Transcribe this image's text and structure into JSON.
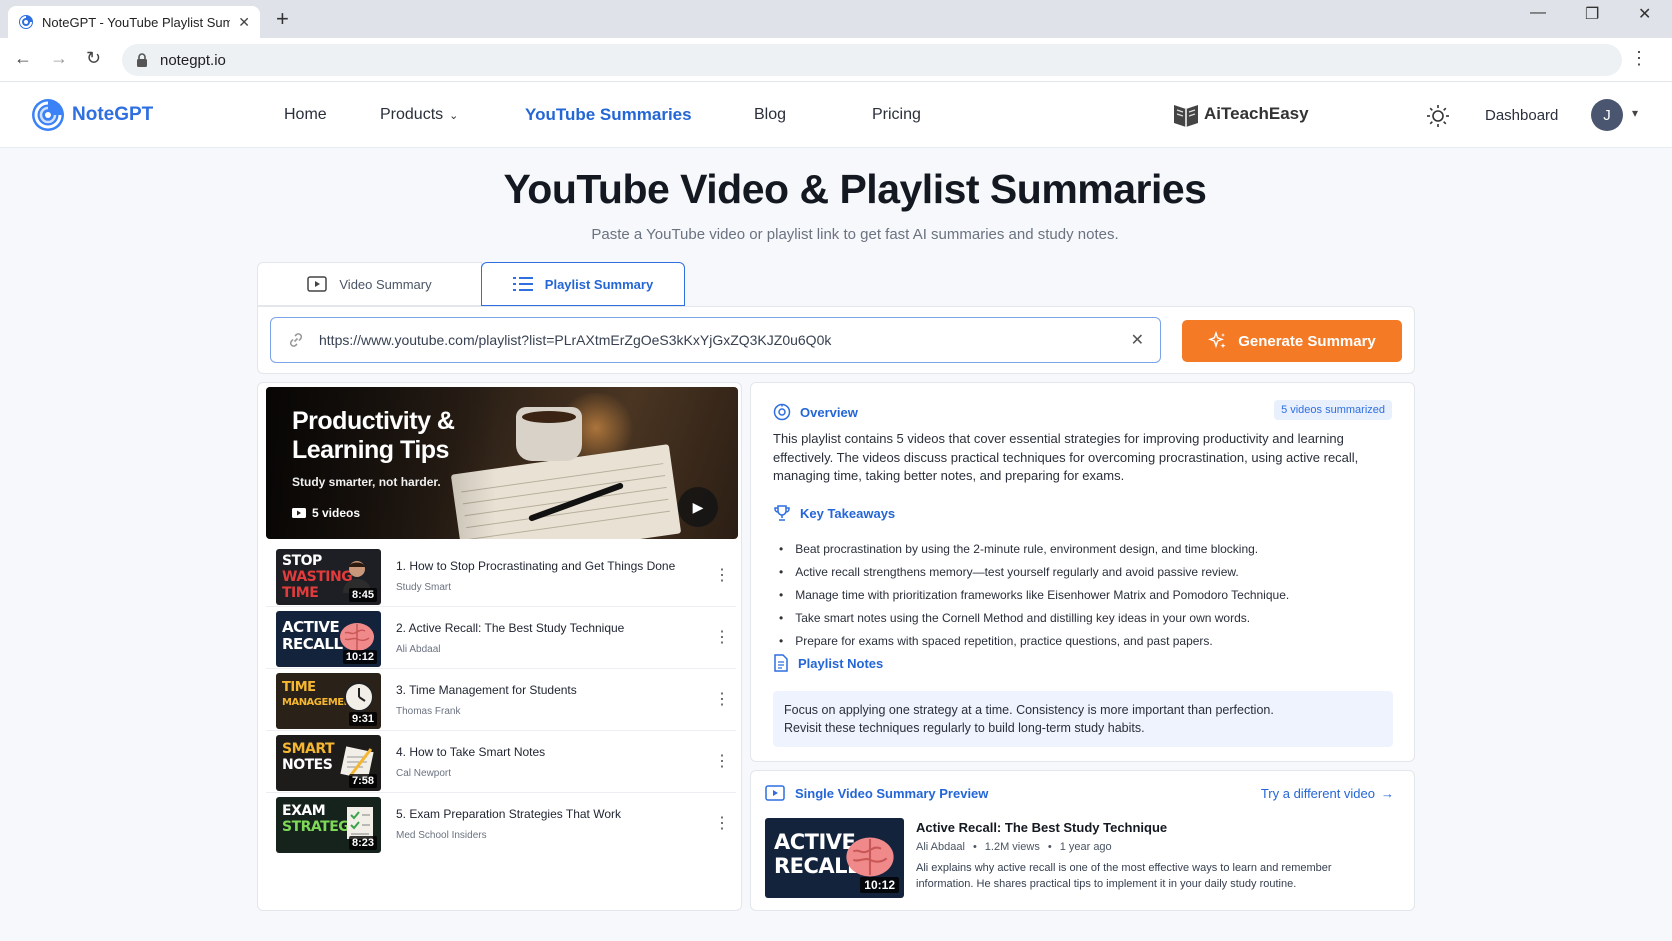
{
  "browser": {
    "tab_title": "NoteGPT - YouTube Playlist Sum",
    "url": "notegpt.io"
  },
  "header": {
    "logo": "NoteGPT",
    "nav": [
      "Home",
      "Products",
      "YouTube Summaries",
      "Blog",
      "Pricing"
    ],
    "partner": "AiTeachEasy",
    "dashboard": "Dashboard",
    "avatar_initial": "J"
  },
  "hero": {
    "title": "YouTube Video & Playlist Summaries",
    "subtitle": "Paste a YouTube video or playlist link to get fast AI summaries and study notes."
  },
  "mode_tabs": {
    "video": "Video Summary",
    "playlist": "Playlist Summary",
    "active": "playlist"
  },
  "input": {
    "value": "https://www.youtube.com/playlist?list=PLrAXtmErZgOeS3kKxYjGxZQ3KJZ0u6Q0k",
    "button": "Generate Summary"
  },
  "playlist": {
    "banner_title": "Productivity & Learning Tips",
    "banner_subtitle": "Study smarter, not harder.",
    "banner_count": "5 videos",
    "videos": [
      {
        "title": "1.  How to Stop Procrastinating and Get Things Done",
        "author": "Study Smart",
        "duration": "8:45",
        "thumb_text": "STOP WASTING TIME"
      },
      {
        "title": "2.  Active Recall: The Best Study Technique",
        "author": "Ali Abdaal",
        "duration": "10:12",
        "thumb_text": "ACTIVE RECALL"
      },
      {
        "title": "3.  Time Management for Students",
        "author": "Thomas Frank",
        "duration": "9:31",
        "thumb_text": "TIME MANAGEMENT"
      },
      {
        "title": "4.  How to Take Smart Notes",
        "author": "Cal Newport",
        "duration": "7:58",
        "thumb_text": "SMART NOTES"
      },
      {
        "title": "5.  Exam Preparation Strategies That Work",
        "author": "Med School Insiders",
        "duration": "8:23",
        "thumb_text": "EXAM STRATEGY"
      }
    ]
  },
  "summary": {
    "overview_heading": "Overview",
    "badge": "5 videos summarized",
    "overview_text": "This playlist contains 5 videos that cover essential strategies for improving productivity and learning effectively. The videos discuss practical techniques for overcoming procrastination, using active recall, managing time, taking better notes, and preparing for exams.",
    "takeaways_heading": "Key Takeaways",
    "takeaways": [
      "Beat procrastination by using the 2-minute rule, environment design, and time blocking.",
      "Active recall strengthens memory—test yourself regularly and avoid passive review.",
      "Manage time with prioritization frameworks like Eisenhower Matrix and Pomodoro Technique.",
      "Take smart notes using the Cornell Method and distilling key ideas in your own words.",
      "Prepare for exams with spaced repetition, practice questions, and past papers."
    ],
    "notes_heading": "Playlist Notes",
    "notes_line1": "Focus on applying one strategy at a time. Consistency is more important than perfection.",
    "notes_line2": "Revisit these techniques regularly to build long-term study habits."
  },
  "preview": {
    "heading": "Single Video Summary Preview",
    "try_link": "Try a different video",
    "title": "Active Recall: The Best Study Technique",
    "author": "Ali Abdaal",
    "views": "1.2M views",
    "age": "1 year ago",
    "duration": "10:12",
    "thumb_text": "ACTIVE RECALL",
    "desc": "Ali explains why active recall is one of the most effective ways to learn and remember information. He shares practical tips to implement it in your daily study routine."
  },
  "colors": {
    "accent": "#2466d6",
    "cta": "#f47a25",
    "page_bg": "#f6f8fb"
  }
}
